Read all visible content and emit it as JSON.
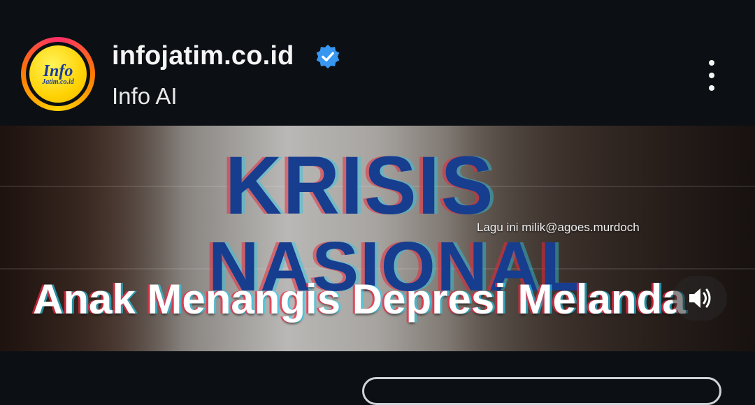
{
  "post_header": {
    "account_name": "infojatim.co.id",
    "subtitle": "Info AI",
    "avatar_logo_main": "Info",
    "avatar_logo_sub": "Jatim.co.id",
    "verified_icon": "verified-badge-icon",
    "menu_icon": "more-vertical-icon"
  },
  "video": {
    "background_text_line1": "KRISIS",
    "background_text_line2": "NASIONAL",
    "credit_text": "Lagu ini milik@agoes.murdoch",
    "caption": "Anak Menangis Depresi Melanda",
    "sound_icon": "volume-on-icon"
  },
  "colors": {
    "background": "#0c1014",
    "verified_blue": "#3897f0",
    "avatar_yellow": "#ffd000",
    "logo_blue": "#1b3c9c"
  }
}
